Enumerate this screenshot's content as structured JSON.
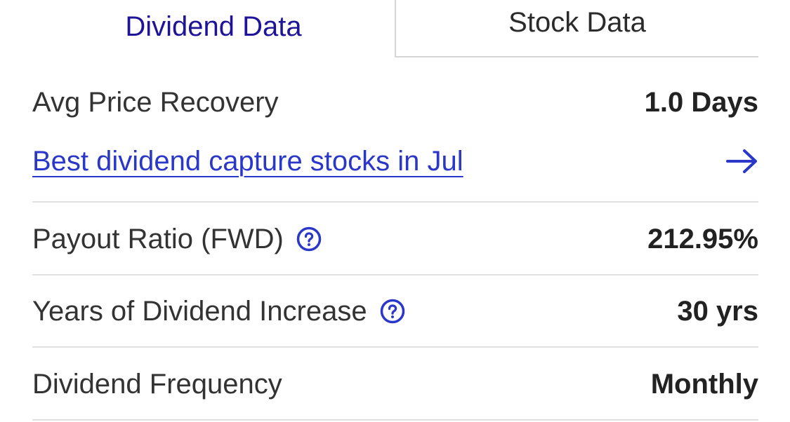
{
  "tabs": {
    "active_label": "Dividend Data",
    "inactive_label": "Stock Data"
  },
  "rows": {
    "avg_price_recovery": {
      "label": "Avg Price Recovery",
      "value": "1.0 Days"
    },
    "capture_link": {
      "label": "Best dividend capture stocks in Jul"
    },
    "payout_ratio": {
      "label": "Payout Ratio (FWD)",
      "value": "212.95%"
    },
    "years_increase": {
      "label": "Years of Dividend Increase",
      "value": "30 yrs"
    },
    "frequency": {
      "label": "Dividend Frequency",
      "value": "Monthly"
    }
  },
  "icons": {
    "help": "question-circle-icon",
    "link_arrow": "arrow-right-icon"
  },
  "colors": {
    "accent": "#2a37c9",
    "active_tab": "#1f1498",
    "divider": "#e0e0e0"
  }
}
